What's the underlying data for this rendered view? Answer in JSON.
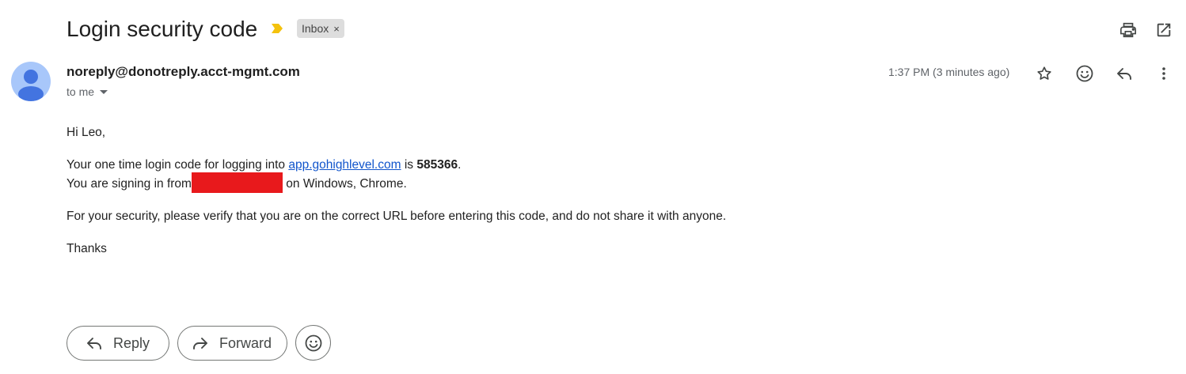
{
  "subject": "Login security code",
  "label_chip": {
    "text": "Inbox",
    "remove_glyph": "×"
  },
  "sender_email": "noreply@donotreply.acct-mgmt.com",
  "recipient": "to me",
  "timestamp": "1:37 PM (3 minutes ago)",
  "icons": {
    "importance": "importance-marker-icon",
    "print": "print-icon",
    "open_new_window": "open-in-new-window-icon",
    "star": "star-icon",
    "emoji": "emoji-reaction-icon",
    "reply": "reply-icon",
    "more": "more-vert-icon",
    "forward": "forward-icon",
    "avatar": "person-avatar-icon"
  },
  "body": {
    "greeting": "Hi Leo,",
    "line1_prefix": "Your one time login code for logging into ",
    "line1_link": "app.gohighlevel.com",
    "line1_mid": " is ",
    "code": "585366",
    "line1_suffix": ".",
    "line2_prefix": "You are signing in from",
    "line2_suffix": " on Windows, Chrome.",
    "security_note": "For your security, please verify that you are on the correct URL before entering this code, and do not share it with anyone.",
    "closing": "Thanks"
  },
  "actions": {
    "reply_label": "Reply",
    "forward_label": "Forward"
  },
  "colors": {
    "importance_marker": "#f4c20d",
    "avatar_bg": "#a8c7fa",
    "avatar_fg": "#4374e0",
    "redaction": "#e8191c",
    "link": "#1155cc",
    "chip_bg": "#dddddd"
  }
}
